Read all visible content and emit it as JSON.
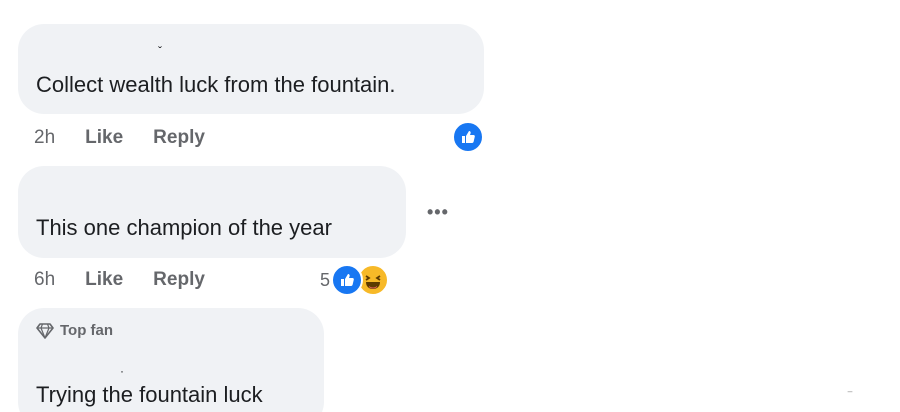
{
  "comments": [
    {
      "text": "Collect wealth luck from the fountain.",
      "time": "2h",
      "like_label": "Like",
      "reply_label": "Reply",
      "reaction_icon": "like-icon"
    },
    {
      "text": "This one champion of the year",
      "time": "6h",
      "like_label": "Like",
      "reply_label": "Reply",
      "reaction_count": "5",
      "reaction_icons": [
        "like-icon",
        "haha-icon"
      ]
    },
    {
      "badge_label": "Top fan",
      "badge_icon": "diamond-icon",
      "text": "Trying the fountain luck"
    }
  ],
  "more_options_label": "•••",
  "colors": {
    "bubble": "#f0f2f5",
    "text": "#1c1e21",
    "meta": "#65676b",
    "like_blue": "#1877f2",
    "haha_yellow": "#f7b928"
  }
}
